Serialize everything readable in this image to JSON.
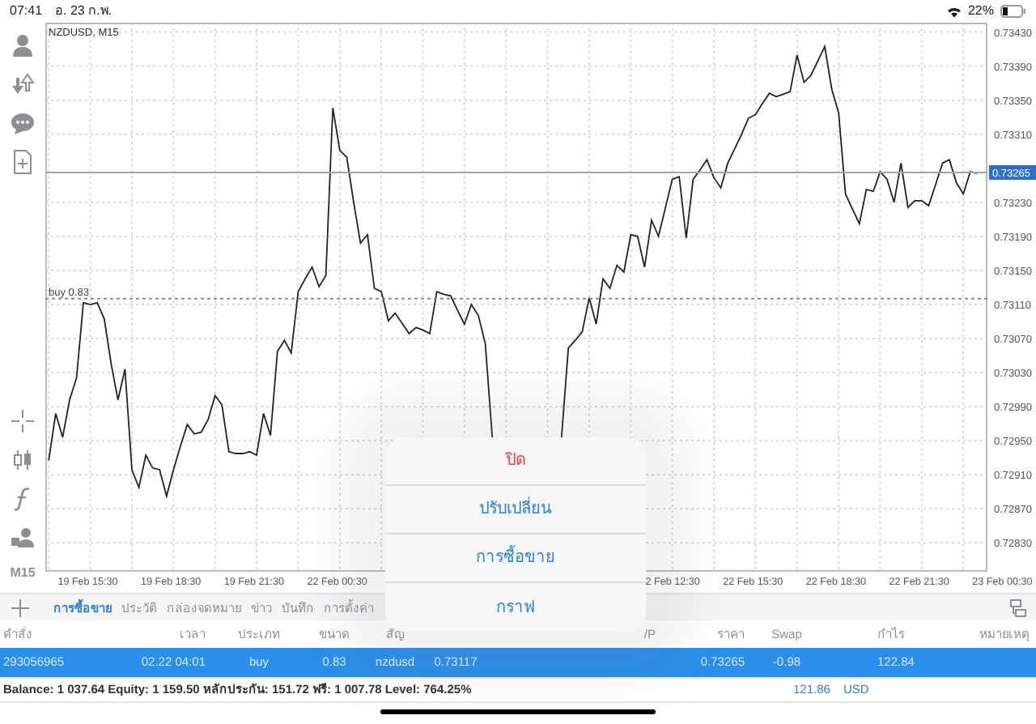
{
  "status_bar": {
    "time": "07:41",
    "date": "อ. 23 ก.พ.",
    "battery": "22%"
  },
  "toolbar": {
    "timeframe": "M15"
  },
  "chart": {
    "chart_data": {
      "type": "line",
      "title": "NZDUSD, M15",
      "categories": [
        null,
        null,
        null,
        null,
        null,
        null,
        null,
        "19 Feb 15:30",
        null,
        null,
        null,
        null,
        null,
        null,
        null,
        null,
        null,
        null,
        null,
        "19 Feb 18:30",
        null,
        null,
        null,
        null,
        null,
        null,
        null,
        null,
        null,
        null,
        null,
        "19 Feb 21:30",
        null,
        null,
        null,
        null,
        null,
        null,
        null,
        null,
        null,
        null,
        null,
        "22 Feb 00:30",
        null,
        null,
        null,
        null,
        null,
        null,
        null,
        null,
        null,
        null,
        null,
        null,
        null,
        null,
        null,
        null,
        null,
        null,
        null,
        null,
        null,
        null,
        null,
        null,
        null,
        null,
        null,
        null,
        null,
        null,
        null,
        null,
        null,
        null,
        null,
        null,
        null,
        null,
        null,
        null,
        null,
        null,
        null,
        null,
        null,
        null,
        null,
        "2 Feb 12:30",
        null,
        null,
        null,
        null,
        null,
        null,
        null,
        null,
        null,
        null,
        null,
        "22 Feb 15:30",
        null,
        null,
        null,
        null,
        null,
        null,
        null,
        null,
        null,
        null,
        null,
        "22 Feb 18:30",
        null,
        null,
        null,
        null,
        null,
        null,
        null,
        null,
        null,
        null,
        null,
        "22 Feb 21:30",
        null,
        null,
        null,
        null,
        null,
        null,
        null,
        null,
        null,
        null,
        null,
        "23 Feb 00:30"
      ],
      "grid": true,
      "series": [
        {
          "color": "#222222",
          "values": [
            null,
            0.72927,
            0.72982,
            0.72954,
            0.72998,
            0.73024,
            0.73112,
            0.7311,
            0.73112,
            0.73093,
            0.7304,
            0.72998,
            0.73034,
            0.72916,
            0.72895,
            0.72933,
            0.72918,
            0.72916,
            0.72885,
            0.72916,
            0.72944,
            0.72969,
            0.72958,
            0.7296,
            0.72975,
            0.73003,
            0.72992,
            0.72937,
            0.72935,
            0.72935,
            0.72937,
            0.72933,
            0.72982,
            0.72956,
            0.73055,
            0.73068,
            0.73053,
            0.73125,
            0.7314,
            0.73154,
            0.73131,
            0.73144,
            0.73341,
            0.73291,
            0.73283,
            0.7323,
            0.73182,
            0.73192,
            0.73129,
            0.73125,
            0.73091,
            0.731,
            0.73088,
            0.73076,
            0.73083,
            0.7308,
            0.73076,
            0.73125,
            0.73122,
            0.7312,
            0.73103,
            0.73087,
            0.7311,
            0.73097,
            0.73064,
            0.72954,
            null,
            null,
            null,
            null,
            null,
            null,
            null,
            null,
            null,
            0.72954,
            0.73059,
            0.73068,
            0.73078,
            0.73118,
            0.73087,
            0.7314,
            0.73129,
            0.73156,
            0.73148,
            0.73192,
            0.7319,
            0.73154,
            0.73209,
            0.7319,
            0.73224,
            0.73257,
            0.7326,
            0.73188,
            0.73257,
            0.73268,
            0.7328,
            0.73259,
            0.73247,
            0.73276,
            0.73293,
            0.7331,
            0.73329,
            0.73333,
            0.73346,
            0.73358,
            0.73354,
            0.73357,
            0.7336,
            0.73403,
            0.73371,
            0.73379,
            0.73396,
            0.73413,
            0.73363,
            0.73335,
            0.7324,
            0.73222,
            0.73205,
            0.73245,
            0.73243,
            0.73266,
            0.73257,
            0.7323,
            0.73276,
            0.73224,
            0.73232,
            0.73232,
            0.73226,
            0.73251,
            0.73276,
            0.7328,
            0.73253,
            0.7324,
            0.73266,
            0.73264,
            null,
            null,
            null,
            null
          ]
        }
      ],
      "ylim": [
        0.72798,
        0.73441
      ],
      "yticks": [
        {
          "value": 0.7343,
          "label": "0.73430"
        },
        {
          "value": 0.7339,
          "label": "0.73390"
        },
        {
          "value": 0.7335,
          "label": "0.73350"
        },
        {
          "value": 0.7331,
          "label": "0.73310"
        },
        {
          "value": 0.7323,
          "label": "0.73230"
        },
        {
          "value": 0.7319,
          "label": "0.73190"
        },
        {
          "value": 0.7315,
          "label": "0.73150"
        },
        {
          "value": 0.7311,
          "label": "0.73110"
        },
        {
          "value": 0.7307,
          "label": "0.73070"
        },
        {
          "value": 0.7303,
          "label": "0.73030"
        },
        {
          "value": 0.7299,
          "label": "0.72990"
        },
        {
          "value": 0.7295,
          "label": "0.72950"
        },
        {
          "value": 0.7291,
          "label": "0.72910"
        },
        {
          "value": 0.7287,
          "label": "0.72870"
        },
        {
          "value": 0.7283,
          "label": "0.72830"
        }
      ],
      "ref_lines": [
        {
          "axis": "y",
          "value": 0.73265,
          "label": "0.73265"
        },
        {
          "axis": "y",
          "value": 0.73117,
          "label": "buy 0.83"
        }
      ]
    }
  },
  "context_menu": {
    "items": [
      {
        "label": "ปิด",
        "kind": "destructive"
      },
      {
        "label": "ปรับเปลี่ยน",
        "kind": "action"
      },
      {
        "label": "การซื้อขาย",
        "kind": "action"
      },
      {
        "label": "กราฟ",
        "kind": "action"
      }
    ]
  },
  "tabs": [
    {
      "label": "การซื้อขาย",
      "selected": true
    },
    {
      "label": "ประวัติ",
      "selected": false
    },
    {
      "label": "กล่องจดหมาย",
      "selected": false
    },
    {
      "label": "ข่าว",
      "selected": false
    },
    {
      "label": "บันทึก",
      "selected": false
    },
    {
      "label": "การตั้งค่า",
      "selected": false
    }
  ],
  "table": {
    "columns": [
      {
        "label": "คำสั่ง"
      },
      {
        "label": "เวลา"
      },
      {
        "label": "ประเภท"
      },
      {
        "label": "ขนาด"
      },
      {
        "label": "สัญ"
      },
      {},
      {},
      {
        "label": "/P"
      },
      {
        "label": "ราคา"
      },
      {
        "label": "Swap"
      },
      {
        "label": "กำไร"
      },
      {
        "label": "หมายเหตุ"
      }
    ],
    "rows": [
      {
        "selected": true,
        "cells": [
          "293056965",
          "02.22 04:01",
          "buy",
          "0.83",
          "nzdusd",
          "0.73117",
          "",
          "",
          "0.73265",
          "-0.98",
          "122.84",
          ""
        ]
      }
    ]
  },
  "summary": {
    "text": "Balance: 1 037.64 Equity: 1 159.50 หลักประกัน: 151.72 ฟรี: 1 007.78 Level: 764.25%",
    "total": "121.86",
    "currency": "USD"
  }
}
